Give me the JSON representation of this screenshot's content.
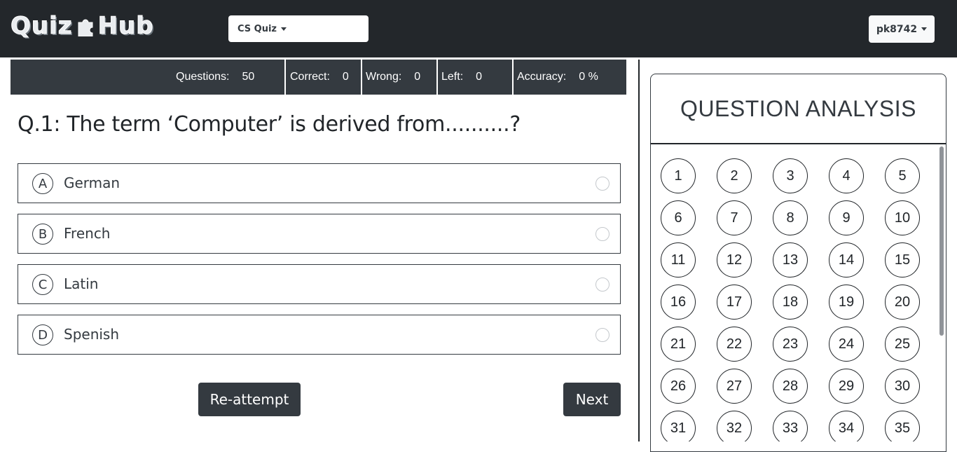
{
  "navbar": {
    "logo": {
      "left": "Quiz",
      "right": "Hub"
    },
    "quiz_select": {
      "label": "CS Quiz"
    },
    "user": {
      "label": "pk8742"
    }
  },
  "stats": {
    "questions_label": "Questions:",
    "questions_value": "50",
    "correct_label": "Correct:",
    "correct_value": "0",
    "wrong_label": "Wrong:",
    "wrong_value": "0",
    "left_label": "Left:",
    "left_value": "0",
    "accuracy_label": "Accuracy:",
    "accuracy_value": "0 %"
  },
  "question": {
    "text": "Q.1:  The term ‘Computer’ is derived from..........?"
  },
  "options": [
    {
      "letter": "A",
      "text": "German"
    },
    {
      "letter": "B",
      "text": "French"
    },
    {
      "letter": "C",
      "text": "Latin"
    },
    {
      "letter": "D",
      "text": "Spenish"
    }
  ],
  "buttons": {
    "reattempt": "Re-attempt",
    "next": "Next"
  },
  "analysis": {
    "title": "QUESTION ANALYSIS",
    "numbers": [
      "1",
      "2",
      "3",
      "4",
      "5",
      "6",
      "7",
      "8",
      "9",
      "10",
      "11",
      "12",
      "13",
      "14",
      "15",
      "16",
      "17",
      "18",
      "19",
      "20",
      "21",
      "22",
      "23",
      "24",
      "25",
      "26",
      "27",
      "28",
      "29",
      "30",
      "31",
      "32",
      "33",
      "34",
      "35"
    ]
  },
  "colors": {
    "navbar_bg": "#23272b",
    "stats_bg": "#343a40",
    "button_bg": "#343a40"
  },
  "icons": {
    "logo_piece": "puzzle-piece-icon",
    "dropdown": "caret-down-icon"
  }
}
